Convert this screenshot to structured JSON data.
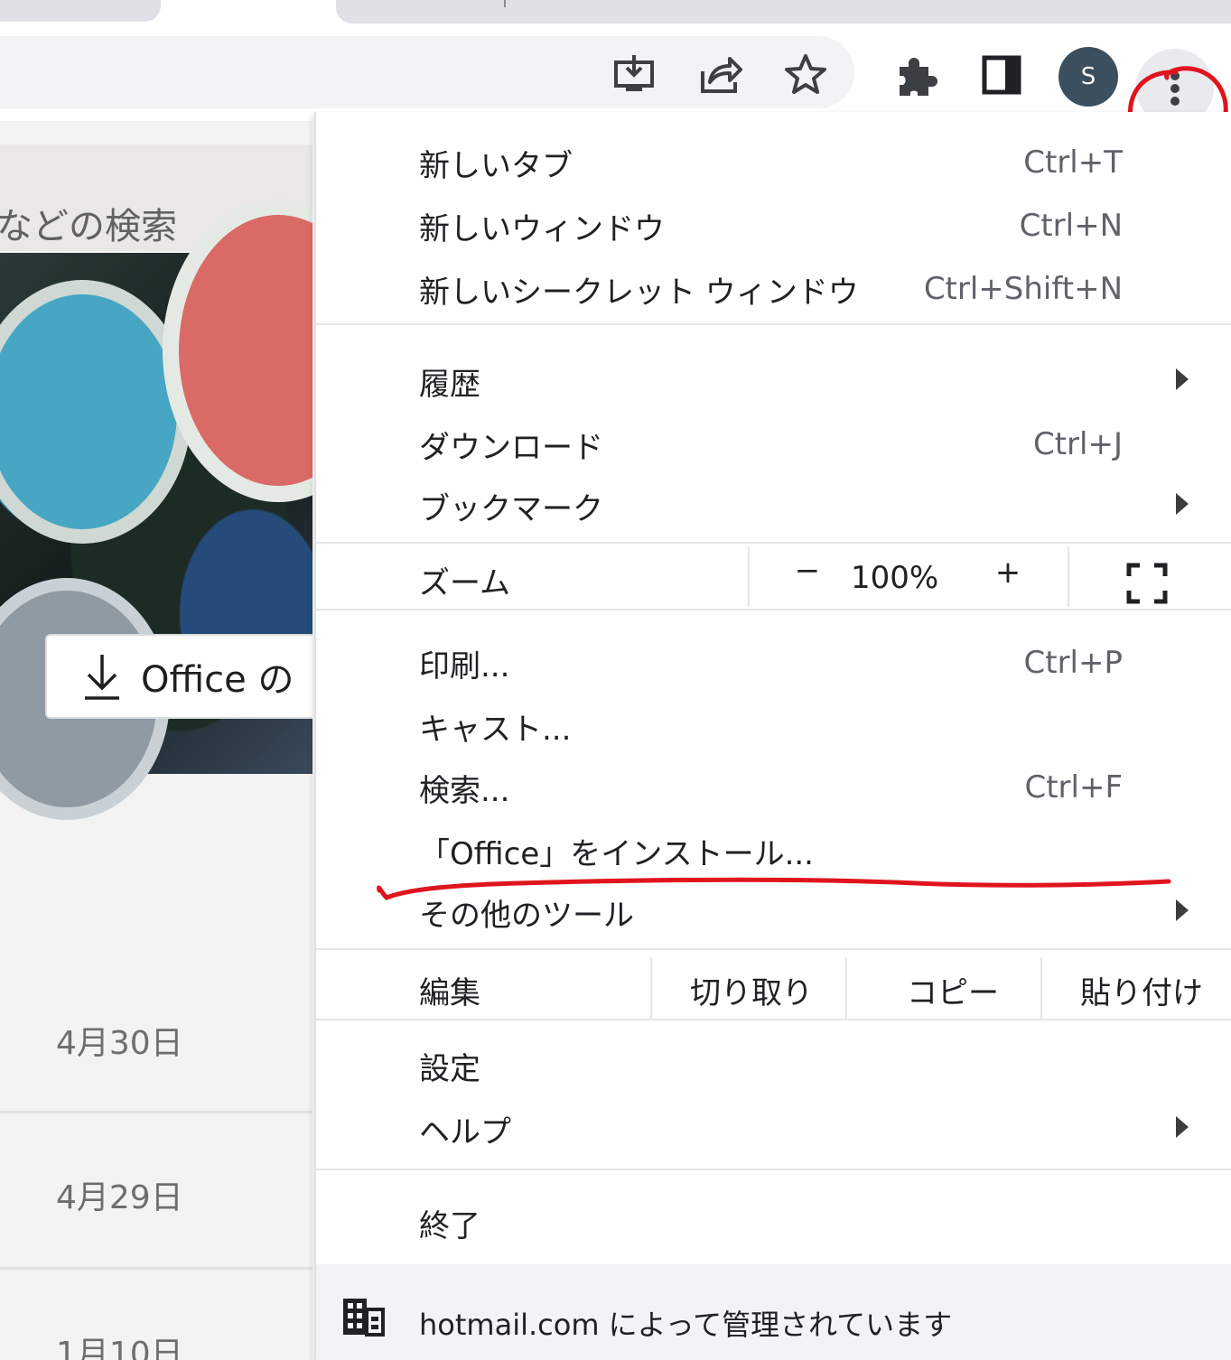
{
  "browser": {
    "profile_initial": "S",
    "icons": [
      "install-app-icon",
      "share-icon",
      "bookmark-star-icon",
      "extensions-icon",
      "side-panel-icon",
      "more-menu-icon"
    ]
  },
  "page": {
    "search_placeholder": "などの検索",
    "download_button_label": "Office の",
    "dates": [
      "4月30日",
      "4月29日",
      "1月10日"
    ]
  },
  "menu": {
    "new_tab": {
      "label": "新しいタブ",
      "shortcut": "Ctrl+T"
    },
    "new_window": {
      "label": "新しいウィンドウ",
      "shortcut": "Ctrl+N"
    },
    "new_incognito": {
      "label": "新しいシークレット ウィンドウ",
      "shortcut": "Ctrl+Shift+N"
    },
    "history": {
      "label": "履歴"
    },
    "downloads": {
      "label": "ダウンロード",
      "shortcut": "Ctrl+J"
    },
    "bookmarks": {
      "label": "ブックマーク"
    },
    "zoom": {
      "label": "ズーム",
      "minus": "−",
      "value": "100%",
      "plus": "+"
    },
    "print": {
      "label": "印刷...",
      "shortcut": "Ctrl+P"
    },
    "cast": {
      "label": "キャスト..."
    },
    "find": {
      "label": "検索...",
      "shortcut": "Ctrl+F"
    },
    "install": {
      "label": "「Office」をインストール..."
    },
    "more_tools": {
      "label": "その他のツール"
    },
    "edit": {
      "label": "編集",
      "cut": "切り取り",
      "copy": "コピー",
      "paste": "貼り付け"
    },
    "settings": {
      "label": "設定"
    },
    "help": {
      "label": "ヘルプ"
    },
    "exit": {
      "label": "終了"
    },
    "managed": {
      "text": "hotmail.com によって管理されています"
    }
  },
  "annotations": {
    "color": "#e0141e"
  }
}
